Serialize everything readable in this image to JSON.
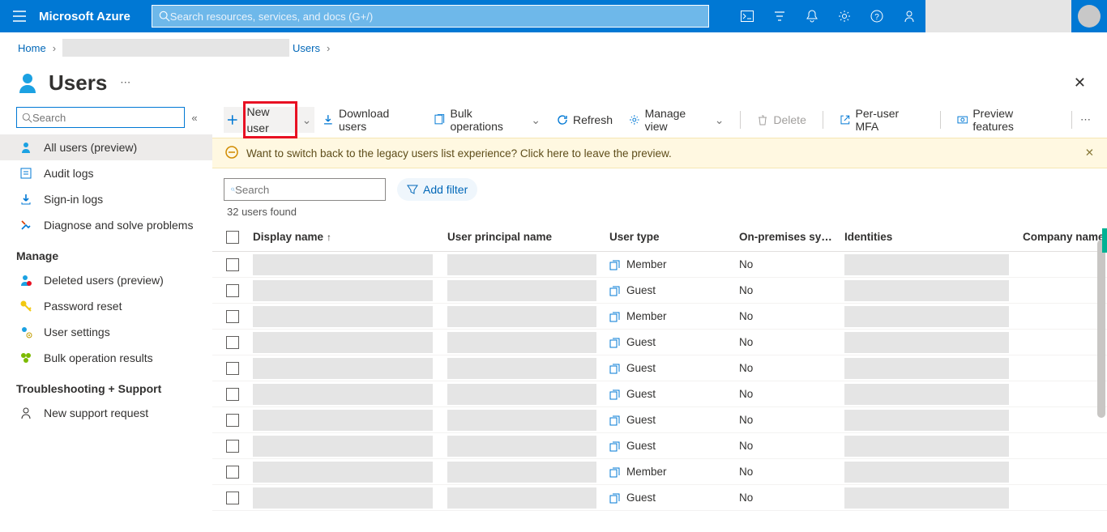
{
  "top": {
    "brand": "Microsoft Azure",
    "search_placeholder": "Search resources, services, and docs (G+/)"
  },
  "breadcrumb": {
    "home": "Home",
    "current": "Users"
  },
  "page": {
    "title": "Users"
  },
  "sidebar": {
    "search_placeholder": "Search",
    "items": [
      {
        "label": "All users (preview)"
      },
      {
        "label": "Audit logs"
      },
      {
        "label": "Sign-in logs"
      },
      {
        "label": "Diagnose and solve problems"
      }
    ],
    "manage_header": "Manage",
    "manage": [
      {
        "label": "Deleted users (preview)"
      },
      {
        "label": "Password reset"
      },
      {
        "label": "User settings"
      },
      {
        "label": "Bulk operation results"
      }
    ],
    "support_header": "Troubleshooting + Support",
    "support": [
      {
        "label": "New support request"
      }
    ]
  },
  "toolbar": {
    "new_user": "New user",
    "download": "Download users",
    "bulk": "Bulk operations",
    "refresh": "Refresh",
    "manage_view": "Manage view",
    "delete": "Delete",
    "mfa": "Per-user MFA",
    "preview": "Preview features"
  },
  "banner": {
    "text": "Want to switch back to the legacy users list experience? Click here to leave the preview."
  },
  "filter": {
    "search_placeholder": "Search",
    "add_filter": "Add filter",
    "count": "32 users found"
  },
  "columns": {
    "display": "Display name",
    "upn": "User principal name",
    "type": "User type",
    "onprem": "On-premises sy…",
    "ident": "Identities",
    "company": "Company name"
  },
  "rows": [
    {
      "type": "Member",
      "onprem": "No"
    },
    {
      "type": "Guest",
      "onprem": "No"
    },
    {
      "type": "Member",
      "onprem": "No"
    },
    {
      "type": "Guest",
      "onprem": "No"
    },
    {
      "type": "Guest",
      "onprem": "No"
    },
    {
      "type": "Guest",
      "onprem": "No"
    },
    {
      "type": "Guest",
      "onprem": "No"
    },
    {
      "type": "Guest",
      "onprem": "No"
    },
    {
      "type": "Member",
      "onprem": "No"
    },
    {
      "type": "Guest",
      "onprem": "No"
    }
  ]
}
